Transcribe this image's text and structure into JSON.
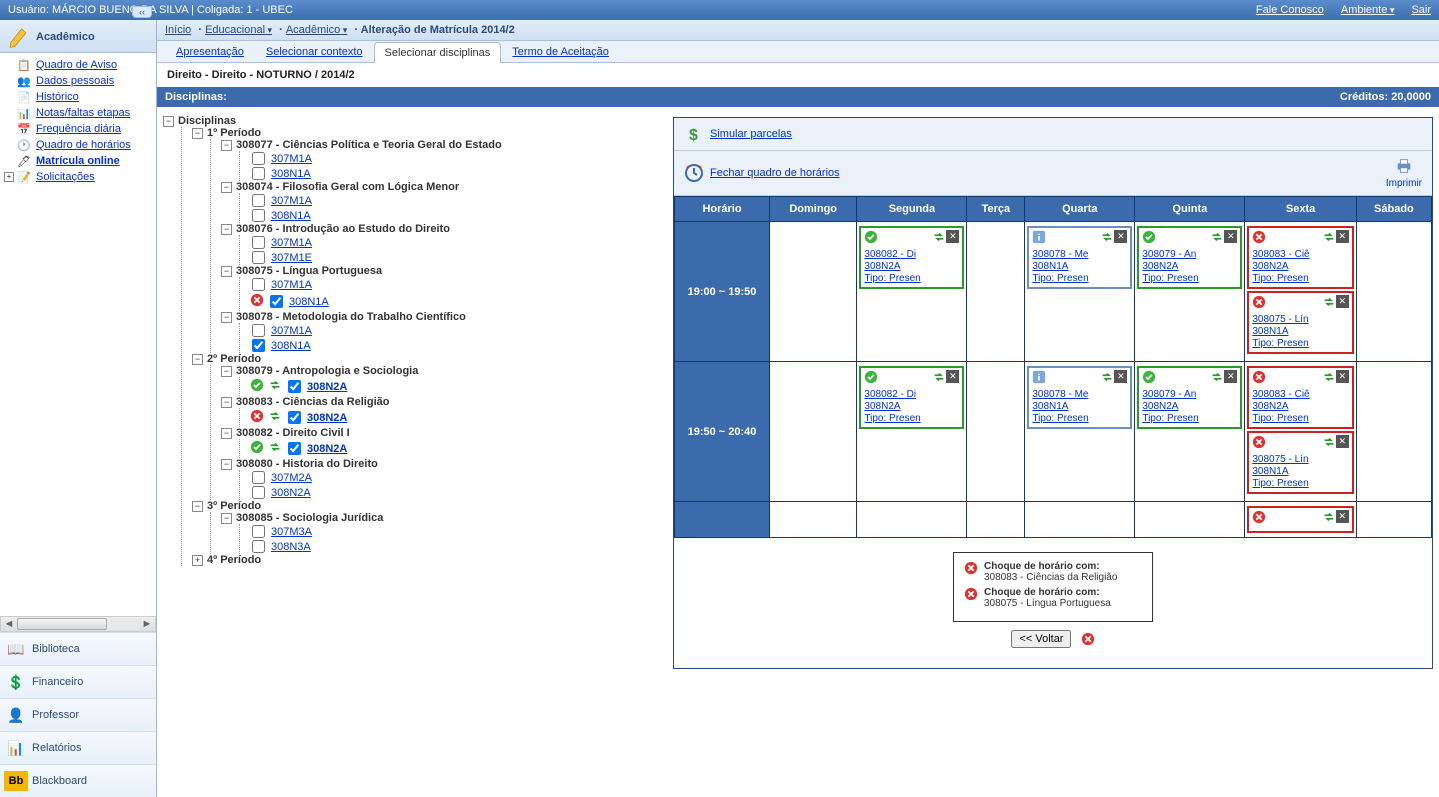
{
  "topbar": {
    "user_prefix": "Usuário: ",
    "user_name": "MÁRCIO BUENO DA SILVA",
    "separator": "  |  ",
    "coligada": "Coligada: 1 - UBEC",
    "fale": "Fale Conosco",
    "ambiente": "Ambiente",
    "sair": "Sair"
  },
  "sidebar": {
    "header": "Acadêmico",
    "collapse": "‹‹",
    "items": [
      {
        "label": "Quadro de Aviso",
        "bold": false
      },
      {
        "label": "Dados pessoais",
        "bold": false
      },
      {
        "label": "Histórico",
        "bold": false
      },
      {
        "label": "Notas/faltas etapas",
        "bold": false
      },
      {
        "label": "Frequência diária",
        "bold": false
      },
      {
        "label": "Quadro de horários",
        "bold": false
      },
      {
        "label": "Matrícula online",
        "bold": true
      },
      {
        "label": "Solicitações",
        "bold": false,
        "plus": true
      }
    ],
    "sections": [
      {
        "label": "Biblioteca"
      },
      {
        "label": "Financeiro"
      },
      {
        "label": "Professor"
      },
      {
        "label": "Relatórios"
      },
      {
        "label": "Blackboard"
      }
    ]
  },
  "breadcrumb": {
    "inicio": "Início",
    "educ": "Educacional",
    "acad": "Acadêmico",
    "title": "Alteração de Matrícula 2014/2"
  },
  "tabs": [
    {
      "label": "Apresentação",
      "active": false
    },
    {
      "label": "Selecionar contexto",
      "active": false
    },
    {
      "label": "Selecionar disciplinas",
      "active": true
    },
    {
      "label": "Termo de Aceitação",
      "active": false
    }
  ],
  "context_title": "Direito - Direito - NOTURNO / 2014/2",
  "section_header": {
    "left": "Disciplinas:",
    "right": "Créditos: 20,0000"
  },
  "tree": {
    "root": "Disciplinas",
    "periods": [
      {
        "label": "1º Período",
        "courses": [
          {
            "label": "308077 - Ciências Política e Teoria Geral do Estado",
            "classes": [
              {
                "label": "307M1A"
              },
              {
                "label": "308N1A"
              }
            ]
          },
          {
            "label": "308074 - Filosofia Geral com Lógica Menor",
            "classes": [
              {
                "label": "307M1A"
              },
              {
                "label": "308N1A"
              }
            ]
          },
          {
            "label": "308076 - Introdução ao Estudo do Direito",
            "classes": [
              {
                "label": "307M1A"
              },
              {
                "label": "307M1E"
              }
            ]
          },
          {
            "label": "308075 - Língua Portuguesa",
            "classes": [
              {
                "label": "307M1A"
              },
              {
                "label": "308N1A",
                "checked": true,
                "err": true
              }
            ]
          },
          {
            "label": "308078 - Metodologia do Trabalho Científico",
            "classes": [
              {
                "label": "307M1A"
              },
              {
                "label": "308N1A",
                "checked": true
              }
            ]
          }
        ]
      },
      {
        "label": "2º Período",
        "courses": [
          {
            "label": "308079 - Antropologia e Sociologia",
            "classes": [
              {
                "label": "308N2A",
                "checked": true,
                "ok": true,
                "swap": true,
                "bold": true
              }
            ]
          },
          {
            "label": "308083 - Ciências da Religião",
            "classes": [
              {
                "label": "308N2A",
                "checked": true,
                "err": true,
                "swap": true,
                "bold": true
              }
            ]
          },
          {
            "label": "308082 - Direito Civil I",
            "classes": [
              {
                "label": "308N2A",
                "checked": true,
                "ok": true,
                "swap": true,
                "bold": true
              }
            ]
          },
          {
            "label": "308080 - Historia do Direito",
            "classes": [
              {
                "label": "307M2A"
              },
              {
                "label": "308N2A"
              }
            ]
          }
        ]
      },
      {
        "label": "3º Período",
        "courses": [
          {
            "label": "308085 - Sociologia Jurídica",
            "classes": [
              {
                "label": "307M3A"
              },
              {
                "label": "308N3A"
              }
            ]
          }
        ]
      },
      {
        "label": "4º Período",
        "collapsed": true
      }
    ]
  },
  "panel": {
    "simular": "Simular parcelas",
    "fechar": "Fechar quadro de horários",
    "imprimir": "Imprimir"
  },
  "schedule": {
    "headers": [
      "Horário",
      "Domingo",
      "Segunda",
      "Terça",
      "Quarta",
      "Quinta",
      "Sexta",
      "Sábado"
    ],
    "rows": [
      {
        "time": "19:00 ~ 19:50",
        "cells": {
          "Segunda": [
            {
              "type": "ok",
              "l1": "308082 - Di",
              "l2": "308N2A",
              "l3": "Tipo: Presen"
            }
          ],
          "Quarta": [
            {
              "type": "info",
              "l1": "308078 - Me",
              "l2": "308N1A",
              "l3": "Tipo: Presen"
            }
          ],
          "Quinta": [
            {
              "type": "ok",
              "l1": "308079 - An",
              "l2": "308N2A",
              "l3": "Tipo: Presen"
            }
          ],
          "Sexta": [
            {
              "type": "err",
              "l1": "308083 - Ciê",
              "l2": "308N2A",
              "l3": "Tipo: Presen"
            },
            {
              "type": "err",
              "l1": "308075 - Lín",
              "l2": "308N1A",
              "l3": "Tipo: Presen"
            }
          ]
        }
      },
      {
        "time": "19:50 ~ 20:40",
        "cells": {
          "Segunda": [
            {
              "type": "ok",
              "l1": "308082 - Di",
              "l2": "308N2A",
              "l3": "Tipo: Presen"
            }
          ],
          "Quarta": [
            {
              "type": "info",
              "l1": "308078 - Me",
              "l2": "308N1A",
              "l3": "Tipo: Presen"
            }
          ],
          "Quinta": [
            {
              "type": "ok",
              "l1": "308079 - An",
              "l2": "308N2A",
              "l3": "Tipo: Presen"
            }
          ],
          "Sexta": [
            {
              "type": "err",
              "l1": "308083 - Ciê",
              "l2": "308N2A",
              "l3": "Tipo: Presen"
            },
            {
              "type": "err",
              "l1": "308075 - Lín",
              "l2": "308N1A",
              "l3": "Tipo: Presen"
            }
          ]
        }
      },
      {
        "time": "",
        "partial": true,
        "cells": {
          "Sexta": [
            {
              "type": "err-partial"
            }
          ]
        }
      }
    ]
  },
  "conflicts": {
    "prefix": "Choque de horário com:",
    "items": [
      "308083 - Ciências da Religião",
      "308075 - Língua Portuguesa"
    ]
  },
  "back_btn": "<< Voltar"
}
